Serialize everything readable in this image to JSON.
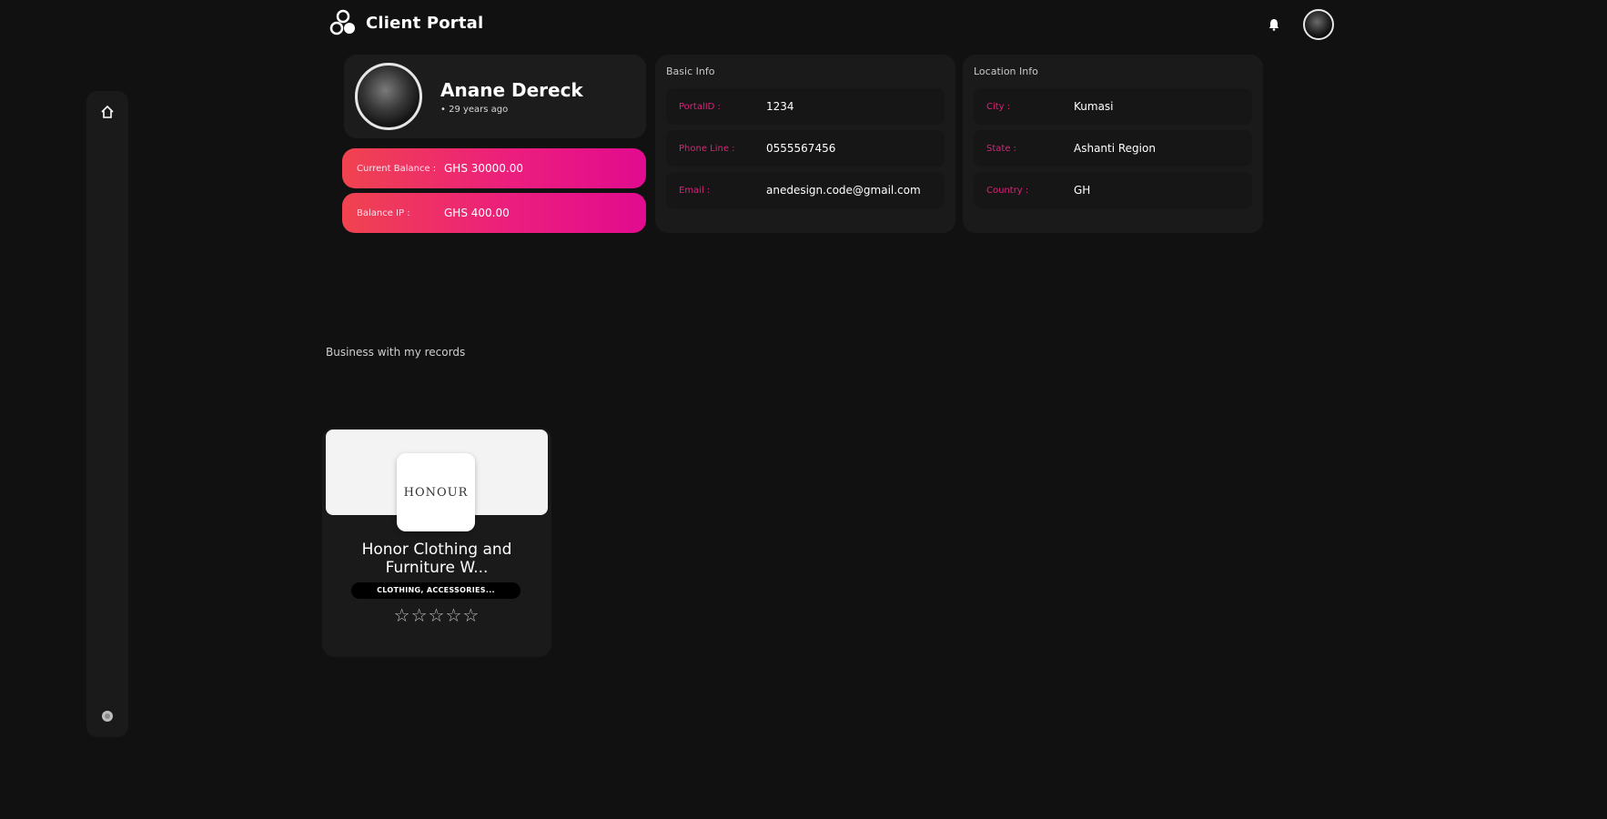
{
  "header": {
    "title": "Client Portal",
    "logo_icon": "cluster-logo-icon",
    "notification_icon": "bell-icon"
  },
  "sidebar": {
    "top_icon": "home-icon",
    "bottom_icon": "settings-dot-icon"
  },
  "profile": {
    "name": "Anane Dereck",
    "subtitle": "• 29 years ago"
  },
  "balances": [
    {
      "label": "Current Balance :",
      "value": "GHS 30000.00"
    },
    {
      "label": "Balance IP :",
      "value": "GHS 400.00"
    }
  ],
  "basic_info": {
    "title": "Basic Info",
    "rows": [
      {
        "key": "PortalID :",
        "value": "1234"
      },
      {
        "key": "Phone Line :",
        "value": "0555567456"
      },
      {
        "key": "Email :",
        "value": "anedesign.code@gmail.com"
      }
    ]
  },
  "location_info": {
    "title": "Location Info",
    "rows": [
      {
        "key": "City :",
        "value": "Kumasi"
      },
      {
        "key": "State :",
        "value": "Ashanti Region"
      },
      {
        "key": "Country :",
        "value": "GH"
      }
    ]
  },
  "business_section": {
    "title": "Business with my records",
    "card": {
      "logo_text": "HONOUR",
      "name": "Honor Clothing and Furniture W...",
      "tag": "CLOTHING, ACCESSORIES...",
      "stars": "☆☆☆☆☆",
      "rating": 0
    }
  },
  "colors": {
    "background": "#111111",
    "accent_pink": "#e0207a",
    "gradient_start": "#f0434f",
    "gradient_end": "#e10b8f"
  }
}
